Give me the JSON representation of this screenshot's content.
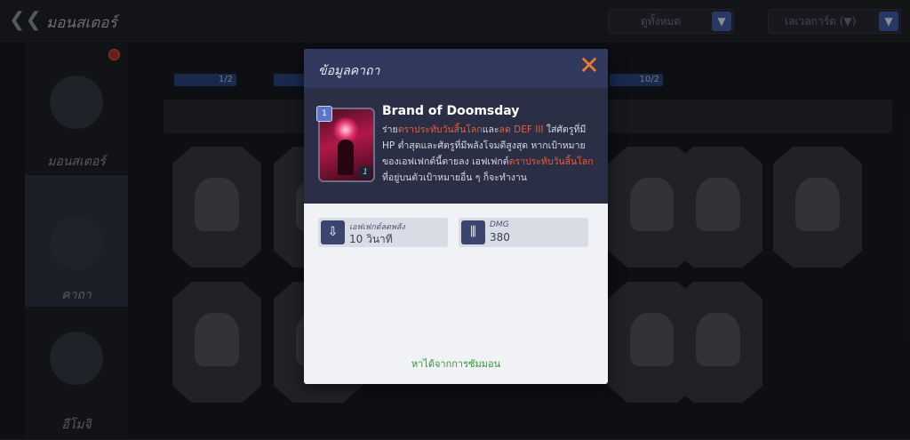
{
  "topbar": {
    "title": "มอนสเตอร์",
    "filter1": "ดูทั้งหมด",
    "filter2": "เลเวลการ์ด (▼)"
  },
  "sidebar": {
    "items": [
      {
        "label": "มอนสเตอร์"
      },
      {
        "label": "คาถา"
      },
      {
        "label": "อีโมจิ"
      }
    ]
  },
  "progress": {
    "left": "1/2",
    "right": "10/2"
  },
  "modal": {
    "title": "ข้อมูลคาถา",
    "skill_name": "Brand of Doomsday",
    "card_level": "1",
    "card_cost": "1",
    "desc": {
      "p1": "ร่าย",
      "h1": "ตราประทับวันสิ้นโลก",
      "p2": "และ",
      "h2": "ลด DEF III",
      "p3": " ใส่ศัตรูที่มี HP ต่ำสุดและศัตรูที่มีพลังโจมตีสูงสุด หากเป้าหมายของเอฟเฟกต์นี้ตายลง เอฟเฟกต์",
      "h3": "ตราประทับวันสิ้นโลก",
      "p4": "ที่อยู่บนตัวเป้าหมายอื่น ๆ ก็จะทำงาน"
    },
    "stats": [
      {
        "label": "เอฟเฟกต์ลดพลัง",
        "value": "10 วินาที",
        "icon": "debuff-timer-icon"
      },
      {
        "label": "DMG",
        "value": "380",
        "icon": "damage-icon"
      }
    ],
    "obtain_text": "หาได้จากการซัมมอน"
  },
  "colors": {
    "accent_orange": "#ef7b2b",
    "highlight_red": "#ef5a3a",
    "obtain_green": "#2d9a2d"
  }
}
